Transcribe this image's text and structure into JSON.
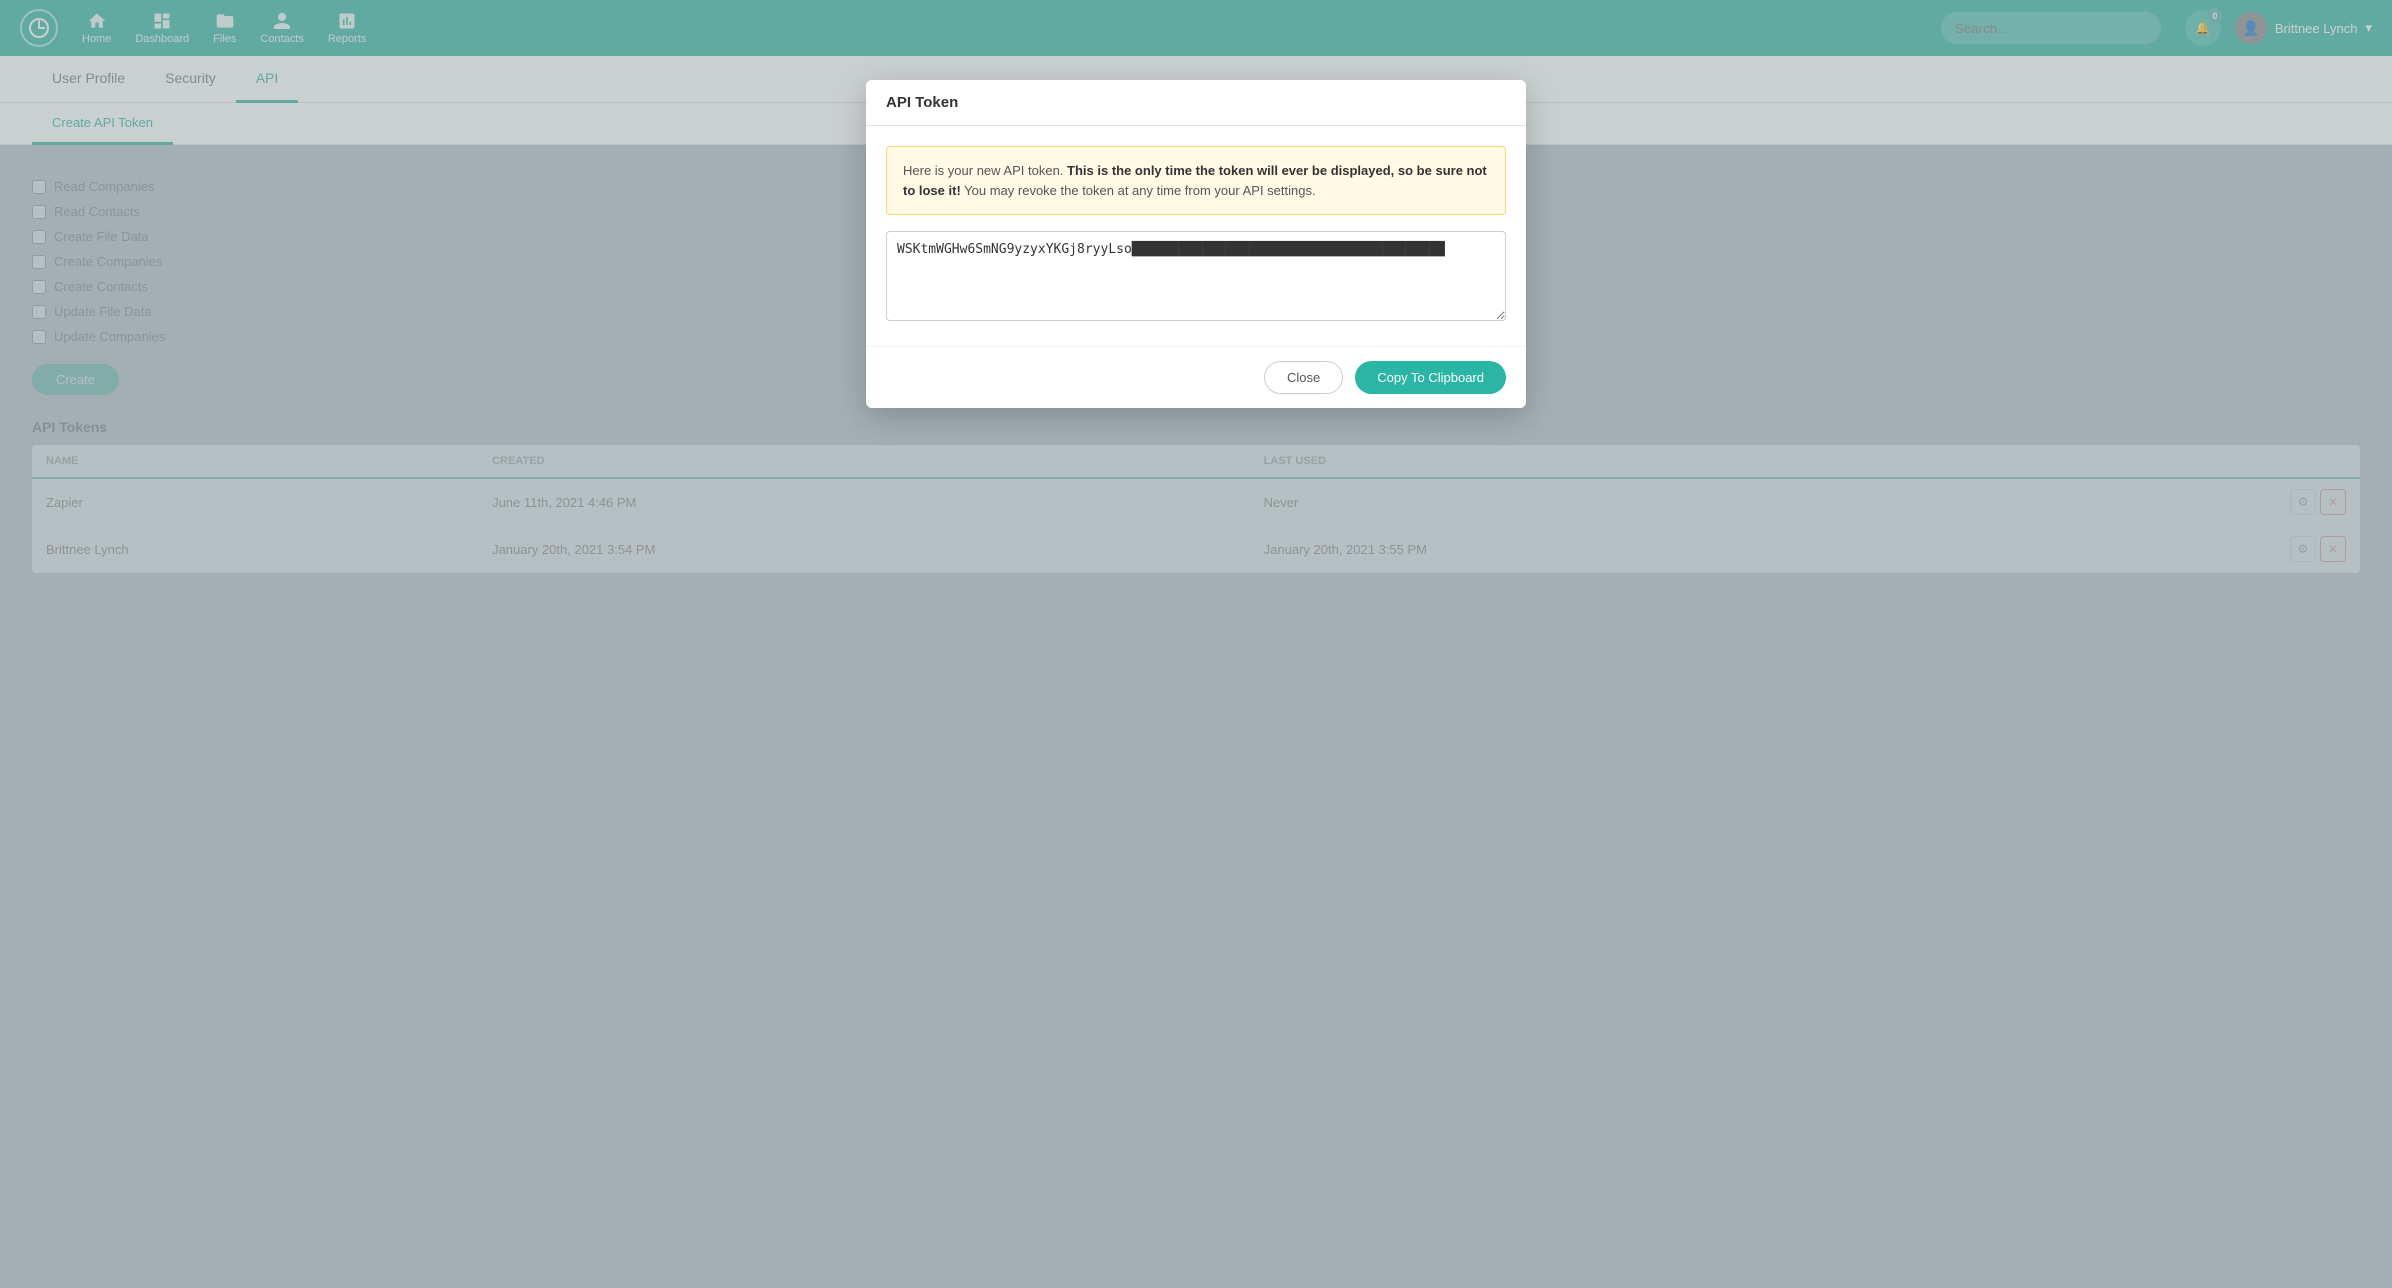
{
  "nav": {
    "items": [
      {
        "label": "Home",
        "icon": "home-icon"
      },
      {
        "label": "Dashboard",
        "icon": "dashboard-icon"
      },
      {
        "label": "Files",
        "icon": "files-icon"
      },
      {
        "label": "Contacts",
        "icon": "contacts-icon"
      },
      {
        "label": "Reports",
        "icon": "reports-icon"
      }
    ],
    "notification_count": "0",
    "user_name": "Brittnee Lynch"
  },
  "tabs": [
    {
      "label": "User Profile"
    },
    {
      "label": "Security"
    },
    {
      "label": "API"
    }
  ],
  "sub_tabs": [
    {
      "label": "Create API Token"
    }
  ],
  "checkboxes": [
    {
      "label": "Read Companies"
    },
    {
      "label": "Read Contacts"
    },
    {
      "label": "Create File Data"
    },
    {
      "label": "Create Companies"
    },
    {
      "label": "Create Contacts"
    },
    {
      "label": "Update File Data"
    },
    {
      "label": "Update Companies"
    }
  ],
  "create_button": "Create",
  "tokens_section": {
    "title": "API Tokens",
    "columns": [
      "NAME",
      "CREATED",
      "LAST USED"
    ],
    "rows": [
      {
        "name": "Zapier",
        "created": "June 11th, 2021 4:46 PM",
        "last_used": "Never"
      },
      {
        "name": "Brittnee Lynch",
        "created": "January 20th, 2021 3:54 PM",
        "last_used": "January 20th, 2021 3:55 PM"
      }
    ]
  },
  "modal": {
    "title": "API Token",
    "alert": {
      "prefix": "Here is your new API token. ",
      "bold": "This is the only time the token will ever be displayed, so be sure not to lose it!",
      "suffix": " You may revoke the token at any time from your API settings."
    },
    "token_value": "WSKtmWGHw6SmNG9yzyxYKGj8ryyLso████████████████████████████████████████",
    "close_label": "Close",
    "copy_label": "Copy To Clipboard"
  }
}
